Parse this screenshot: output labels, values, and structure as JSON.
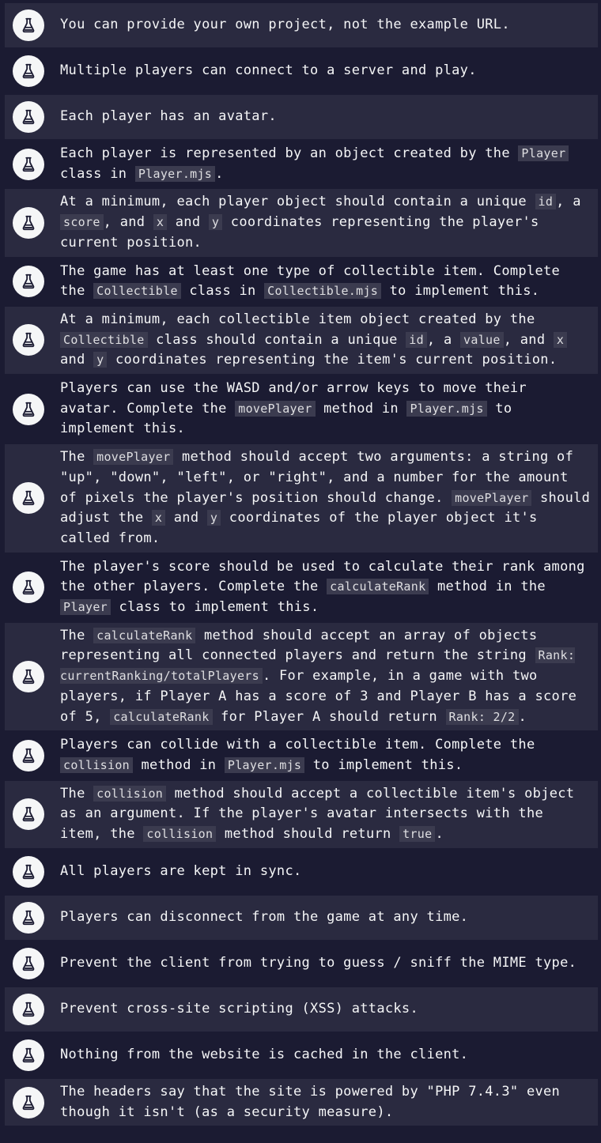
{
  "icon": "flask-icon",
  "items": [
    {
      "parts": [
        {
          "t": "You can provide your own project, not the example URL."
        }
      ]
    },
    {
      "parts": [
        {
          "t": "Multiple players can connect to a server and play."
        }
      ]
    },
    {
      "parts": [
        {
          "t": "Each player has an avatar."
        }
      ]
    },
    {
      "parts": [
        {
          "t": "Each player is represented by an object created by the "
        },
        {
          "c": "Player"
        },
        {
          "t": " class in "
        },
        {
          "c": "Player.mjs"
        },
        {
          "t": "."
        }
      ]
    },
    {
      "parts": [
        {
          "t": "At a minimum, each player object should contain a unique "
        },
        {
          "c": "id"
        },
        {
          "t": ", a "
        },
        {
          "c": "score"
        },
        {
          "t": ", and "
        },
        {
          "c": "x"
        },
        {
          "t": " and "
        },
        {
          "c": "y"
        },
        {
          "t": " coordinates representing the player's current position."
        }
      ]
    },
    {
      "parts": [
        {
          "t": "The game has at least one type of collectible item. Complete the "
        },
        {
          "c": "Collectible"
        },
        {
          "t": " class in "
        },
        {
          "c": "Collectible.mjs"
        },
        {
          "t": " to implement this."
        }
      ]
    },
    {
      "parts": [
        {
          "t": "At a minimum, each collectible item object created by the "
        },
        {
          "c": "Collectible"
        },
        {
          "t": " class should contain a unique "
        },
        {
          "c": "id"
        },
        {
          "t": ", a "
        },
        {
          "c": "value"
        },
        {
          "t": ", and "
        },
        {
          "c": "x"
        },
        {
          "t": " and "
        },
        {
          "c": "y"
        },
        {
          "t": " coordinates representing the item's current position."
        }
      ]
    },
    {
      "parts": [
        {
          "t": "Players can use the WASD and/or arrow keys to move their avatar. Complete the "
        },
        {
          "c": "movePlayer"
        },
        {
          "t": " method in "
        },
        {
          "c": "Player.mjs"
        },
        {
          "t": " to implement this."
        }
      ]
    },
    {
      "parts": [
        {
          "t": "The "
        },
        {
          "c": "movePlayer"
        },
        {
          "t": " method should accept two arguments: a string of \"up\", \"down\", \"left\", or \"right\", and a number for the amount of pixels the player's position should change. "
        },
        {
          "c": "movePlayer"
        },
        {
          "t": " should adjust the "
        },
        {
          "c": "x"
        },
        {
          "t": " and "
        },
        {
          "c": "y"
        },
        {
          "t": " coordinates of the player object it's called from."
        }
      ]
    },
    {
      "parts": [
        {
          "t": "The player's score should be used to calculate their rank among the other players. Complete the "
        },
        {
          "c": "calculateRank"
        },
        {
          "t": " method in the "
        },
        {
          "c": "Player"
        },
        {
          "t": " class to implement this."
        }
      ]
    },
    {
      "parts": [
        {
          "t": "The "
        },
        {
          "c": "calculateRank"
        },
        {
          "t": " method should accept an array of objects representing all connected players and return the string "
        },
        {
          "c": "Rank: currentRanking/totalPlayers"
        },
        {
          "t": ". For example, in a game with two players, if Player A has a score of 3 and Player B has a score of 5, "
        },
        {
          "c": "calculateRank"
        },
        {
          "t": " for Player A should return "
        },
        {
          "c": "Rank: 2/2"
        },
        {
          "t": "."
        }
      ]
    },
    {
      "parts": [
        {
          "t": "Players can collide with a collectible item. Complete the "
        },
        {
          "c": "collision"
        },
        {
          "t": " method in "
        },
        {
          "c": "Player.mjs"
        },
        {
          "t": " to implement this."
        }
      ]
    },
    {
      "parts": [
        {
          "t": "The "
        },
        {
          "c": "collision"
        },
        {
          "t": " method should accept a collectible item's object as an argument. If the player's avatar intersects with the item, the "
        },
        {
          "c": "collision"
        },
        {
          "t": " method should return "
        },
        {
          "c": "true"
        },
        {
          "t": "."
        }
      ]
    },
    {
      "parts": [
        {
          "t": "All players are kept in sync."
        }
      ]
    },
    {
      "parts": [
        {
          "t": "Players can disconnect from the game at any time."
        }
      ]
    },
    {
      "parts": [
        {
          "t": "Prevent the client from trying to guess / sniff the MIME type."
        }
      ]
    },
    {
      "parts": [
        {
          "t": "Prevent cross-site scripting (XSS) attacks."
        }
      ]
    },
    {
      "parts": [
        {
          "t": "Nothing from the website is cached in the client."
        }
      ]
    },
    {
      "parts": [
        {
          "t": "The headers say that the site is powered by \"PHP 7.4.3\" even though it isn't (as a security measure)."
        }
      ]
    }
  ]
}
